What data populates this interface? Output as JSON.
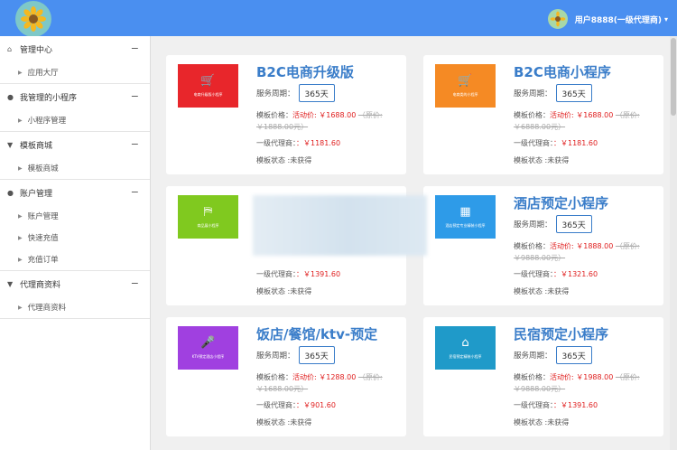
{
  "header": {
    "user": "用户8888(一级代理商)",
    "accent": "#4a8ff0"
  },
  "sidebar": {
    "groups": [
      {
        "label": "管理中心",
        "icon": "home-icon",
        "items": [
          "应用大厅"
        ]
      },
      {
        "label": "我管理的小程序",
        "icon": "chat-icon",
        "items": [
          "小程序管理"
        ]
      },
      {
        "label": "模板商城",
        "icon": "cart-icon",
        "items": [
          "模板商城"
        ]
      },
      {
        "label": "账户管理",
        "icon": "user-icon",
        "items": [
          "账户管理",
          "快速充值",
          "充值订单"
        ]
      },
      {
        "label": "代理商资料",
        "icon": "filter-icon",
        "items": [
          "代理商资料"
        ]
      }
    ]
  },
  "cards": [
    {
      "title": "B2C电商升级版",
      "service_label": "服务周期：",
      "days": "365天",
      "thumb_color": "#e8262b",
      "thumb_icon": "shop-e-icon",
      "thumb_text": "电商升级版小程序",
      "price_label": "模板价格：",
      "act": "活动价: ￥1688.00",
      "orig": "（原价:￥1888.00元）",
      "agent_label": "一级代理商：",
      "agent": "：￥1181.60",
      "status": "模板状态 :未获得"
    },
    {
      "title": "B2C电商小程序",
      "service_label": "服务周期：",
      "days": "365天",
      "thumb_color": "#f58a24",
      "thumb_icon": "shop-e-icon",
      "thumb_text": "电商类的小程序",
      "price_label": "模板价格：",
      "act": "活动价: ￥1688.00",
      "orig": "（原价:￥6888.00元）",
      "agent_label": "一级代理商：",
      "agent": "：￥1181.60",
      "status": "模板状态 :未获得"
    },
    {
      "title": "",
      "service_label": "",
      "days": "",
      "thumb_color": "#80c91f",
      "thumb_icon": "signpost-icon",
      "thumb_text": "商品展小程序",
      "price_label": "",
      "act": "",
      "orig": "",
      "agent_label": "一级代理商：",
      "agent": "：￥1391.60",
      "status": "模板状态 :未获得"
    },
    {
      "title": "酒店预定小程序",
      "service_label": "服务周期：",
      "days": "365天",
      "thumb_color": "#2e9be8",
      "thumb_icon": "building-icon",
      "thumb_text": "酒店预定专业精装小程序",
      "price_label": "模板价格：",
      "act": "活动价: ￥1888.00",
      "orig": "（原价:￥9888.00元）",
      "agent_label": "一级代理商：",
      "agent": "：￥1321.60",
      "status": "模板状态 :未获得"
    },
    {
      "title": "饭店/餐馆/ktv-预定",
      "service_label": "服务周期：",
      "days": "365天",
      "thumb_color": "#a040e0",
      "thumb_icon": "microphone-icon",
      "thumb_text": "KTV预定酒店小程序",
      "price_label": "模板价格：",
      "act": "活动价: ￥1288.00",
      "orig": "（原价:￥1688.00元）",
      "agent_label": "一级代理商：",
      "agent": "：￥901.60",
      "status": "模板状态 :未获得"
    },
    {
      "title": "民宿预定小程序",
      "service_label": "服务周期：",
      "days": "365天",
      "thumb_color": "#1f9ac9",
      "thumb_icon": "house-icon",
      "thumb_text": "民宿预定精装小程序",
      "price_label": "模板价格：",
      "act": "活动价: ￥1988.00",
      "orig": "（原价:￥9888.00元）",
      "agent_label": "一级代理商：",
      "agent": "：￥1391.60",
      "status": "模板状态 :未获得"
    }
  ]
}
